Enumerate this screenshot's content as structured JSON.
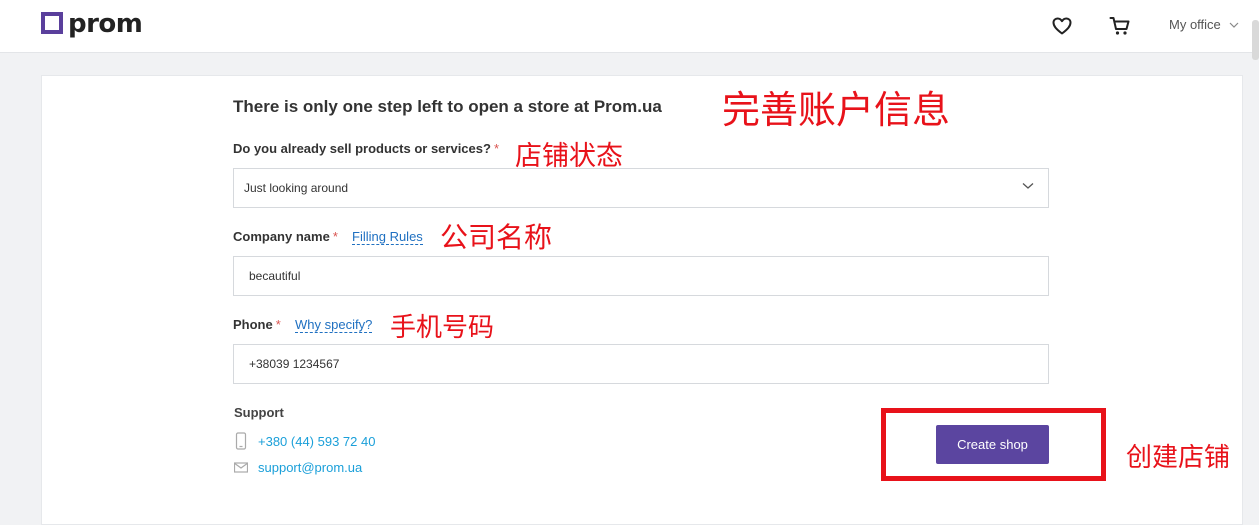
{
  "header": {
    "logo_text": "prom",
    "favorites_icon": "heart-icon",
    "cart_icon": "cart-icon",
    "account_label": "My office"
  },
  "form": {
    "heading": "There is only one step left to open a store at Prom.ua",
    "sell_question": {
      "label": "Do you already sell products or services?",
      "required_mark": "*",
      "selected_value": "Just looking around"
    },
    "company": {
      "label": "Company name",
      "required_mark": "*",
      "help_link": "Filling Rules",
      "value": "becautiful"
    },
    "phone": {
      "label": "Phone",
      "required_mark": "*",
      "help_link": "Why specify?",
      "value": "+38039 1234567"
    },
    "support": {
      "title": "Support",
      "phone": "+380 (44) 593 72 40",
      "email": "support@prom.ua"
    },
    "submit_label": "Create shop"
  },
  "annotations": {
    "heading": "完善账户信息",
    "shop_status": "店铺状态",
    "company_name": "公司名称",
    "phone_number": "手机号码",
    "create_shop": "创建店铺"
  },
  "colors": {
    "brand": "#5a3f9c",
    "button": "#5b45a0",
    "link": "#1f70c1",
    "support_link": "#1a9fd9",
    "annotation": "#e8121a",
    "required": "#d9534f"
  }
}
